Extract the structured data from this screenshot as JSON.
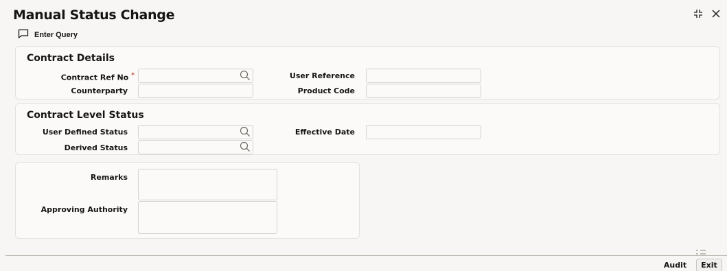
{
  "window": {
    "title": "Manual Status Change"
  },
  "toolbar": {
    "enter_query_label": "Enter Query"
  },
  "contract_details": {
    "title": "Contract Details",
    "contract_ref_no_label": "Contract Ref No",
    "required_marker": "*",
    "contract_ref_no_value": "",
    "counterparty_label": "Counterparty",
    "counterparty_value": "",
    "user_reference_label": "User Reference",
    "user_reference_value": "",
    "product_code_label": "Product Code",
    "product_code_value": ""
  },
  "contract_level_status": {
    "title": "Contract Level Status",
    "user_defined_status_label": "User Defined Status",
    "user_defined_status_value": "",
    "derived_status_label": "Derived Status",
    "derived_status_value": "",
    "effective_date_label": "Effective Date",
    "effective_date_value": ""
  },
  "remarks_section": {
    "remarks_label": "Remarks",
    "approving_authority_label": "Approving Authority"
  },
  "footer": {
    "audit_label": "Audit",
    "exit_label": "Exit"
  },
  "icons": {
    "enter_query": "chat-bubble-icon",
    "search": "search-icon",
    "collapse": "collapse-icon",
    "close": "close-icon",
    "footer_menu": "menu-lines-icon"
  },
  "colors": {
    "required": "#c74634",
    "text": "#161513",
    "background": "#f7f6f4"
  }
}
